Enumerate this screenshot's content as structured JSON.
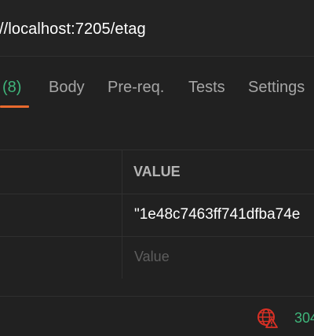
{
  "request": {
    "url": "//localhost:7205/etag"
  },
  "tabs": [
    {
      "label": "(8)"
    },
    {
      "label": "Body"
    },
    {
      "label": "Pre-req."
    },
    {
      "label": "Tests"
    },
    {
      "label": "Settings"
    }
  ],
  "headers_table": {
    "value_header": "VALUE",
    "rows": [
      {
        "value": "\"1e48c7463ff741dfba74e"
      },
      {
        "placeholder": "Value"
      }
    ]
  },
  "footer": {
    "status": "304",
    "icon": "globe-error-icon",
    "status_color": "#3fb57a",
    "error_color": "#d93025"
  },
  "colors": {
    "accent_tab_underline": "#e8692e",
    "count_badge": "#3fb57a"
  }
}
